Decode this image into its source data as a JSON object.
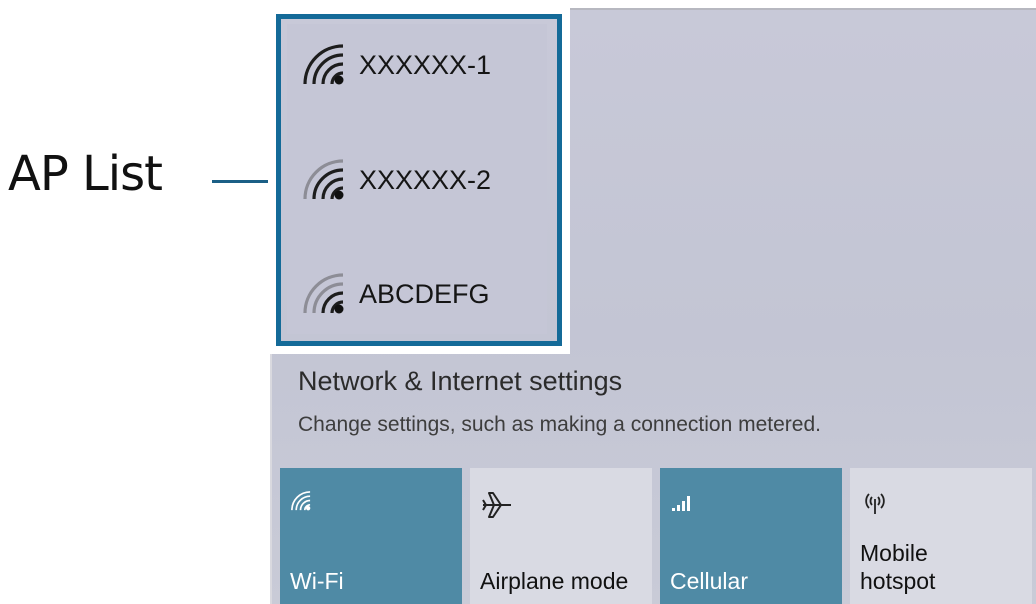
{
  "callout": {
    "label": "AP List"
  },
  "ap_list": {
    "items": [
      {
        "ssid": "XXXXXX-1",
        "icon": "wifi-signal-full-icon",
        "signal_bars": 4
      },
      {
        "ssid": "XXXXXX-2",
        "icon": "wifi-signal-medium-icon",
        "signal_bars": 3
      },
      {
        "ssid": "ABCDEFG",
        "icon": "wifi-signal-low-icon",
        "signal_bars": 2
      }
    ]
  },
  "network_settings": {
    "title": "Network & Internet settings",
    "subtitle": "Change settings, such as making a connection metered."
  },
  "quick_actions": [
    {
      "label": "Wi-Fi",
      "icon": "wifi-icon",
      "active": true
    },
    {
      "label": "Airplane mode",
      "icon": "airplane-icon",
      "active": false
    },
    {
      "label": "Cellular",
      "icon": "cellular-signal-icon",
      "active": true
    },
    {
      "label": "Mobile hotspot",
      "icon": "mobile-hotspot-icon",
      "active": false
    }
  ],
  "colors": {
    "accent": "#146a98",
    "tile_active": "#4f8aa5",
    "tile_inactive": "#d9dae3",
    "panel_background": "#c6c7d6"
  }
}
